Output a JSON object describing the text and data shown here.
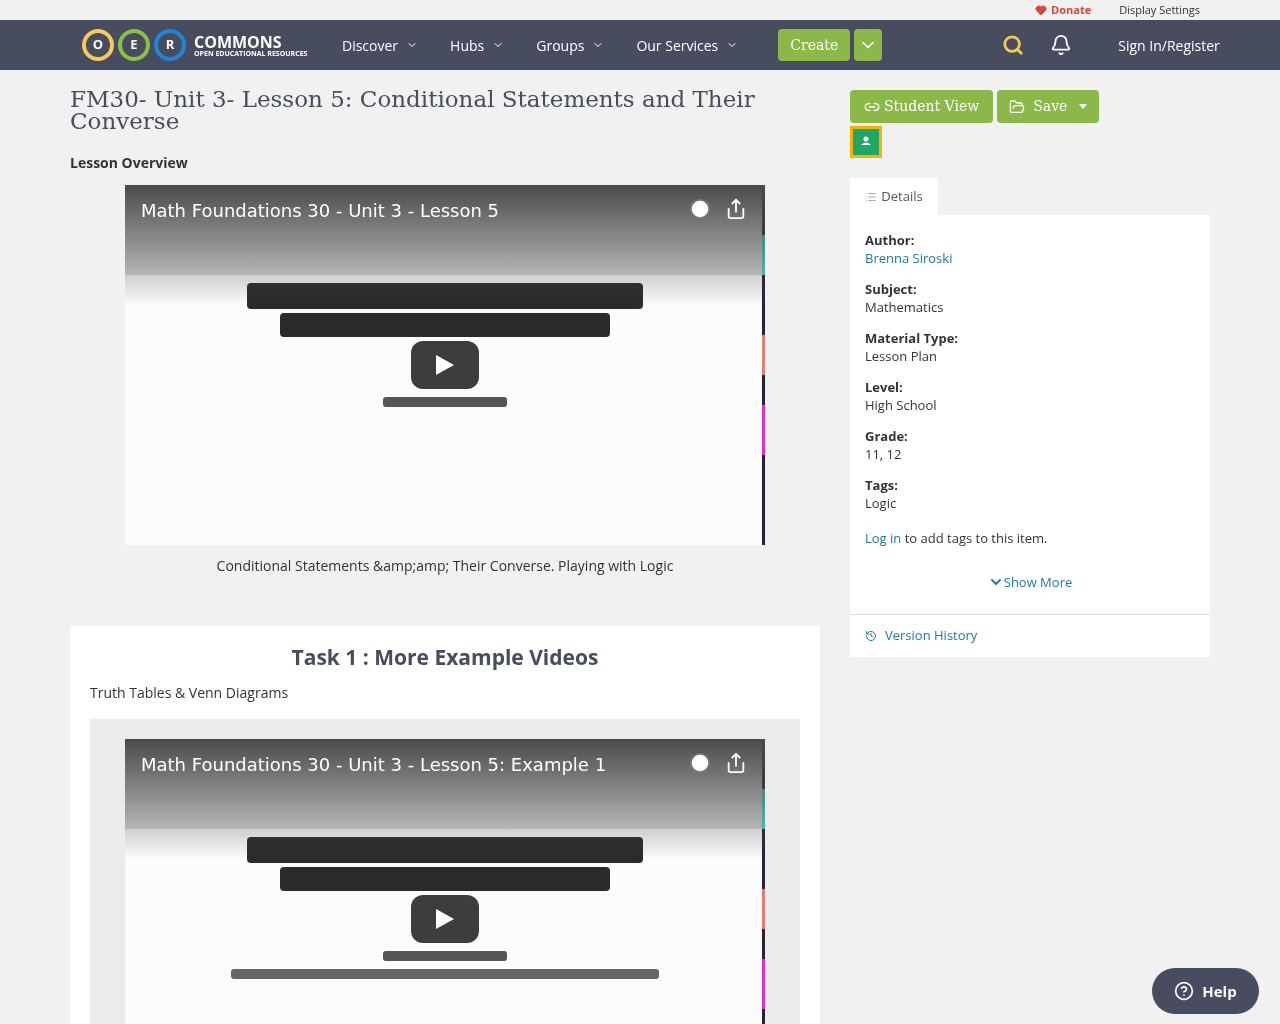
{
  "top_bar": {
    "donate": "Donate",
    "display_settings": "Display Settings"
  },
  "nav": {
    "logo": {
      "letters": [
        "O",
        "E",
        "R"
      ],
      "name": "COMMONS",
      "tagline": "OPEN EDUCATIONAL RESOURCES"
    },
    "menu": [
      "Discover",
      "Hubs",
      "Groups",
      "Our Services"
    ],
    "create": "Create",
    "sign_in": "Sign In/Register"
  },
  "title": "FM30- Unit 3- Lesson 5: Conditional Statements and Their Converse",
  "overview": {
    "heading": "Lesson Overview",
    "video_title": "Math Foundations 30 - Unit 3 - Lesson 5",
    "caption": "Conditional Statements &amp;amp; Their Converse. Playing with Logic"
  },
  "task": {
    "heading": "Task 1 : More Example Videos",
    "subtitle": "Truth Tables & Venn Diagrams",
    "video_title": "Math Foundations 30 - Unit 3 - Lesson 5: Example 1"
  },
  "sidebar": {
    "student_view": "Student View",
    "save": "Save",
    "tab": "Details",
    "fields": [
      {
        "label": "Author:",
        "value": "Brenna Siroski",
        "kind": "link"
      },
      {
        "label": "Subject:",
        "value": "Mathematics",
        "kind": "text"
      },
      {
        "label": "Material Type:",
        "value": "Lesson Plan",
        "kind": "text"
      },
      {
        "label": "Level:",
        "value": "High School",
        "kind": "text"
      },
      {
        "label": "Grade:",
        "value": "11, 12",
        "kind": "text"
      },
      {
        "label": "Tags:",
        "value": "Logic",
        "kind": "text"
      }
    ],
    "tags_note": {
      "link": "Log in",
      "text": "to add tags to this item."
    },
    "show_more": "Show More",
    "version_history": "Version History"
  },
  "help": "Help"
}
